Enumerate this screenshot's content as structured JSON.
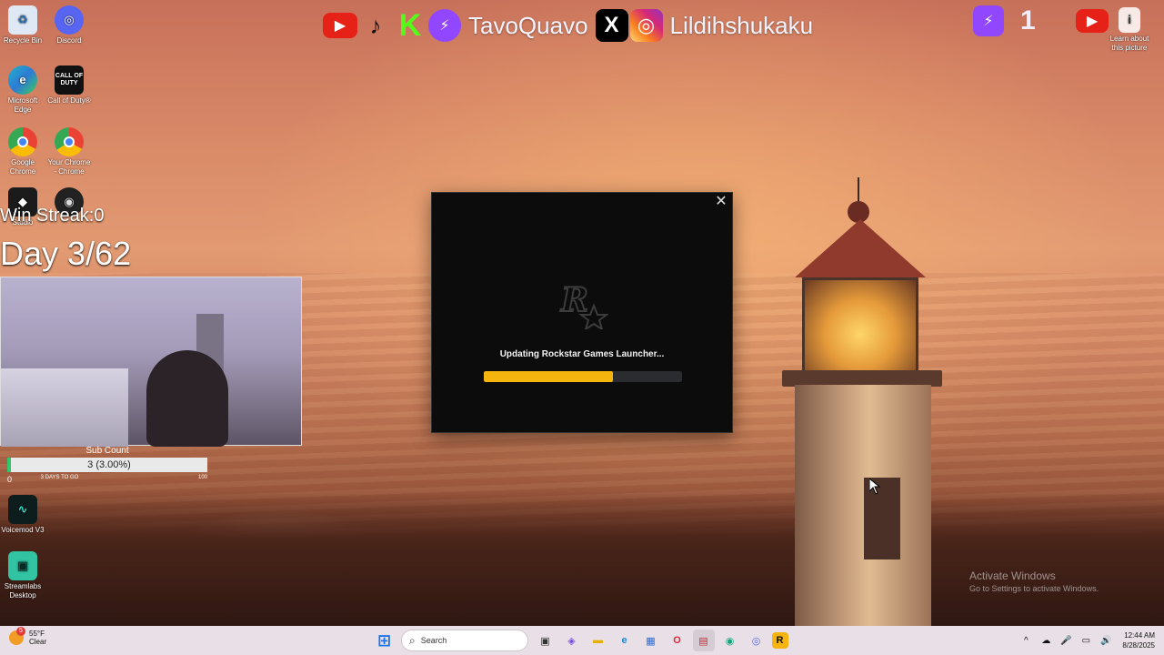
{
  "desktop": {
    "icons": [
      {
        "label": "Recycle Bin",
        "icon": "recycle-bin-icon"
      },
      {
        "label": "Discord",
        "icon": "discord-icon"
      },
      {
        "label": "Microsoft Edge",
        "icon": "edge-icon"
      },
      {
        "label": "Call of Duty®",
        "icon": "call-of-duty-icon",
        "glyph": "CALL OF DUTY"
      },
      {
        "label": "Google Chrome",
        "icon": "chrome-icon"
      },
      {
        "label": "Your Chrome - Chrome",
        "icon": "chrome-profile-icon"
      },
      {
        "label": "Studio",
        "icon": "roblox-studio-icon"
      },
      {
        "label": "",
        "icon": "obs-icon"
      },
      {
        "label": "Voicemod V3",
        "icon": "voicemod-icon"
      },
      {
        "label": "Streamlabs Desktop",
        "icon": "streamlabs-icon"
      },
      {
        "label": "Learn about this picture",
        "icon": "spotlight-icon"
      }
    ]
  },
  "overlay": {
    "handle_1": "TavoQuavo",
    "handle_2": "Lildihshukaku",
    "twitch_count": "1",
    "win_streak": "Win Streak:0",
    "day_counter": "Day 3/62",
    "social_icons": [
      "youtube-icon",
      "tiktok-icon",
      "kick-icon",
      "twitch-icon",
      "x-icon",
      "instagram-icon"
    ],
    "glyphs": {
      "kick": "K",
      "twitch": "⚡",
      "x": "X",
      "instagram": "◎",
      "youtube": "▶",
      "tiktok": "♪"
    }
  },
  "sub_count": {
    "title": "Sub Count",
    "value_text": "3 (3.00%)",
    "progress_fraction": 0.03,
    "min_label": "0",
    "days_label": "3 DAYS TO GO",
    "max_label": "100"
  },
  "dialog": {
    "message": "Updating Rockstar Games Launcher...",
    "close_glyph": "✕",
    "progress_fraction": 0.65,
    "accent": "#f5b50e",
    "logo_glyph": "R★"
  },
  "taskbar": {
    "weather_temp": "55°F",
    "weather_desc": "Clear",
    "weather_badge": "5",
    "search_placeholder": "Search",
    "search_glyph": "⌕",
    "time": "12:44 AM",
    "date": "8/28/2025",
    "tray_glyphs": [
      "^",
      "☁",
      "🎤",
      "▭",
      "🔊"
    ],
    "apps": [
      {
        "name": "start-button",
        "glyph": "⊞"
      },
      {
        "name": "task-view-button",
        "glyph": "▣"
      },
      {
        "name": "copilot-button",
        "glyph": "◈"
      },
      {
        "name": "file-explorer-button",
        "glyph": "▬"
      },
      {
        "name": "edge-taskbar-button",
        "glyph": "e"
      },
      {
        "name": "store-taskbar-button",
        "glyph": "▦"
      },
      {
        "name": "opera-taskbar-button",
        "glyph": "O"
      },
      {
        "name": "app-taskbar-button",
        "glyph": "▤"
      },
      {
        "name": "streamlabs-taskbar-button",
        "glyph": "◉"
      },
      {
        "name": "discord-taskbar-button",
        "glyph": "◎"
      },
      {
        "name": "rockstar-taskbar-button",
        "glyph": "R"
      }
    ]
  },
  "watermark": {
    "line1": "Activate Windows",
    "line2": "Go to Settings to activate Windows."
  }
}
